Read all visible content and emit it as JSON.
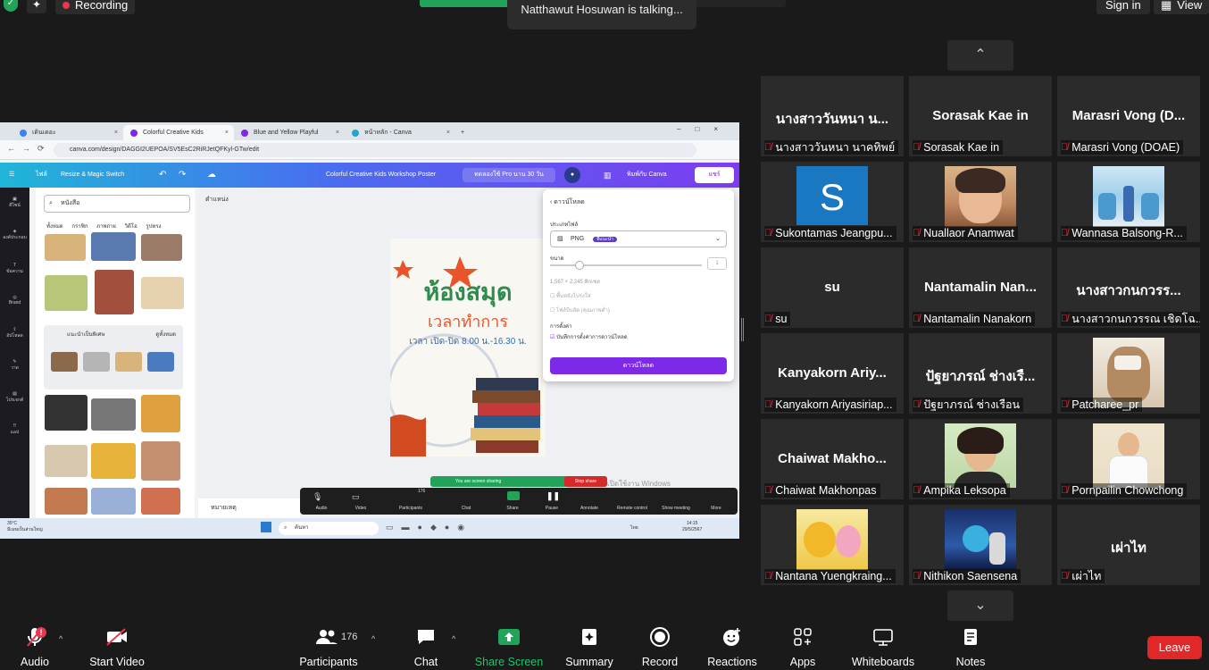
{
  "top": {
    "recording": "Recording",
    "talking": "Natthawut Hosuwan is talking...",
    "sign_in": "Sign in",
    "view": "View"
  },
  "shared_screen": {
    "tabs": [
      "เดินเดอะ",
      "Colorful Creative Kids Worksho...",
      "Blue and Yellow Playful Doodle...",
      "หน้าหลัก - Canva"
    ],
    "url": "canva.com/design/DAGGI2UEPOA/SV5EsC2RiRJetQFKyl-GTw/edit",
    "canva_file": "ไฟล์",
    "canva_resize": "Resize & Magic Switch",
    "canva_title": "Colorful Creative Kids Workshop Poster",
    "pro_pill": "ทดลองใช้ Pro นาน 30 วัน",
    "print_btn": "พิมพ์กับ Canva",
    "share_btn": "แชร์",
    "search_value": "หนังสือ",
    "categories": "ทั้งหมด กราฟิก ภาพถ่าย วิดีโอ รูปทรง",
    "group_title": "แนะนำเป็นพิเศษ",
    "group_see_all": "ดูทั้งหมด",
    "editor_label": "ตำแหน่ง",
    "notes": "หมายเหตุ",
    "poster": {
      "title": "ห้องสมุด",
      "subtitle": "เวลาทำการ",
      "hours": "เวลา เปิด-ปิด 8.00 น.-16.30 น."
    },
    "download": {
      "header": "ดาวน์โหลด",
      "file_type_label": "ประเภทไฟล์",
      "file_type": "PNG",
      "suggested": "ที่แนะนำ",
      "size_label": "ขนาด",
      "size_value": "1",
      "dims": "1,587 × 2,245 พิกเซล",
      "opt1": "พื้นหลังโปร่งใส",
      "opt2": "ไฟล์บีบอัด (คุณภาพต่ำ)",
      "settings_label": "การตั้งค่า",
      "save_setting": "บันทึกการตั้งค่าการดาวน์โหลด",
      "button": "ดาวน์โหลด"
    },
    "screen_sharing": "You are screen sharing",
    "stop_share": "Stop share",
    "mini_toolbar": [
      "Audio",
      "Video",
      "Participants",
      "Chat",
      "Share",
      "Pause",
      "Annotate",
      "Remote control",
      "Show meeting",
      "More"
    ],
    "mini_participants": "176",
    "watermark": "เปิดใช้งาน Windows",
    "weather": "35°C",
    "weather_desc": "มีเมฆเป็นส่วนใหญ่",
    "taskbar_search": "ค้นหา",
    "clock_time": "14:15",
    "clock_date": "29/5/2567",
    "lang": "ไทย"
  },
  "gallery": {
    "tiles": [
      {
        "big": "นางสาววันหนา น...",
        "label": "นางสาววันหนา นาคทิพย์"
      },
      {
        "big": "Sorasak Kae in",
        "label": "Sorasak Kae in"
      },
      {
        "big": "Marasri Vong (D...",
        "label": "Marasri Vong (DOAE)"
      },
      {
        "big": "",
        "label": "Sukontamas Jeangpu..."
      },
      {
        "big": "",
        "label": "Nuallaor Anamwat"
      },
      {
        "big": "",
        "label": "Wannasa Balsong-R..."
      },
      {
        "big": "su",
        "label": "su"
      },
      {
        "big": "Nantamalin Nan...",
        "label": "Nantamalin Nanakorn"
      },
      {
        "big": "นางสาวกนกวรร...",
        "label": "นางสาวกนกวรรณ เชิดโฉ..."
      },
      {
        "big": "Kanyakorn Ariy...",
        "label": "Kanyakorn Ariyasiriap..."
      },
      {
        "big": "ปัฐยาภรณ์ ช่างเรื...",
        "label": "ปัฐยาภรณ์ ช่างเรือน"
      },
      {
        "big": "",
        "label": "Patcharee_pr"
      },
      {
        "big": "Chaiwat Makho...",
        "label": "Chaiwat Makhonpas"
      },
      {
        "big": "",
        "label": "Ampika Leksopa"
      },
      {
        "big": "",
        "label": "Pornpailin Chowchong"
      },
      {
        "big": "",
        "label": "Nantana Yuengkraing..."
      },
      {
        "big": "",
        "label": "Nithikon Saensena"
      },
      {
        "big": "เผ่าไท",
        "label": "เผ่าไท"
      }
    ],
    "avatar_letter": "S"
  },
  "toolbar": {
    "audio": "Audio",
    "start_video": "Start Video",
    "participants": "Participants",
    "participant_count": "176",
    "chat": "Chat",
    "share_screen": "Share Screen",
    "summary": "Summary",
    "record": "Record",
    "reactions": "Reactions",
    "apps": "Apps",
    "whiteboards": "Whiteboards",
    "notes": "Notes",
    "leave": "Leave",
    "audio_alert": "!"
  },
  "colors": {
    "accent_green": "#23a35a",
    "leave_red": "#e02828",
    "canva_purple": "#7d2ae8",
    "tile_bg": "#2b2b2b"
  }
}
